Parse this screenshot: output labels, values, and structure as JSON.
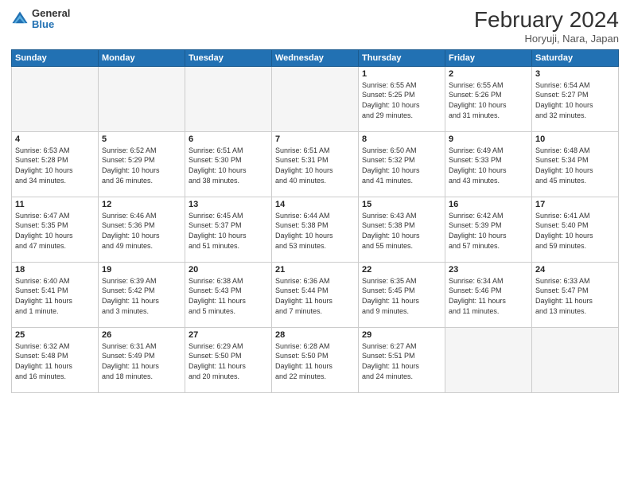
{
  "logo": {
    "general": "General",
    "blue": "Blue"
  },
  "title": "February 2024",
  "subtitle": "Horyuji, Nara, Japan",
  "headers": [
    "Sunday",
    "Monday",
    "Tuesday",
    "Wednesday",
    "Thursday",
    "Friday",
    "Saturday"
  ],
  "weeks": [
    [
      {
        "num": "",
        "info": "",
        "empty": true
      },
      {
        "num": "",
        "info": "",
        "empty": true
      },
      {
        "num": "",
        "info": "",
        "empty": true
      },
      {
        "num": "",
        "info": "",
        "empty": true
      },
      {
        "num": "1",
        "info": "Sunrise: 6:55 AM\nSunset: 5:25 PM\nDaylight: 10 hours\nand 29 minutes."
      },
      {
        "num": "2",
        "info": "Sunrise: 6:55 AM\nSunset: 5:26 PM\nDaylight: 10 hours\nand 31 minutes."
      },
      {
        "num": "3",
        "info": "Sunrise: 6:54 AM\nSunset: 5:27 PM\nDaylight: 10 hours\nand 32 minutes."
      }
    ],
    [
      {
        "num": "4",
        "info": "Sunrise: 6:53 AM\nSunset: 5:28 PM\nDaylight: 10 hours\nand 34 minutes."
      },
      {
        "num": "5",
        "info": "Sunrise: 6:52 AM\nSunset: 5:29 PM\nDaylight: 10 hours\nand 36 minutes."
      },
      {
        "num": "6",
        "info": "Sunrise: 6:51 AM\nSunset: 5:30 PM\nDaylight: 10 hours\nand 38 minutes."
      },
      {
        "num": "7",
        "info": "Sunrise: 6:51 AM\nSunset: 5:31 PM\nDaylight: 10 hours\nand 40 minutes."
      },
      {
        "num": "8",
        "info": "Sunrise: 6:50 AM\nSunset: 5:32 PM\nDaylight: 10 hours\nand 41 minutes."
      },
      {
        "num": "9",
        "info": "Sunrise: 6:49 AM\nSunset: 5:33 PM\nDaylight: 10 hours\nand 43 minutes."
      },
      {
        "num": "10",
        "info": "Sunrise: 6:48 AM\nSunset: 5:34 PM\nDaylight: 10 hours\nand 45 minutes."
      }
    ],
    [
      {
        "num": "11",
        "info": "Sunrise: 6:47 AM\nSunset: 5:35 PM\nDaylight: 10 hours\nand 47 minutes."
      },
      {
        "num": "12",
        "info": "Sunrise: 6:46 AM\nSunset: 5:36 PM\nDaylight: 10 hours\nand 49 minutes."
      },
      {
        "num": "13",
        "info": "Sunrise: 6:45 AM\nSunset: 5:37 PM\nDaylight: 10 hours\nand 51 minutes."
      },
      {
        "num": "14",
        "info": "Sunrise: 6:44 AM\nSunset: 5:38 PM\nDaylight: 10 hours\nand 53 minutes."
      },
      {
        "num": "15",
        "info": "Sunrise: 6:43 AM\nSunset: 5:38 PM\nDaylight: 10 hours\nand 55 minutes."
      },
      {
        "num": "16",
        "info": "Sunrise: 6:42 AM\nSunset: 5:39 PM\nDaylight: 10 hours\nand 57 minutes."
      },
      {
        "num": "17",
        "info": "Sunrise: 6:41 AM\nSunset: 5:40 PM\nDaylight: 10 hours\nand 59 minutes."
      }
    ],
    [
      {
        "num": "18",
        "info": "Sunrise: 6:40 AM\nSunset: 5:41 PM\nDaylight: 11 hours\nand 1 minute."
      },
      {
        "num": "19",
        "info": "Sunrise: 6:39 AM\nSunset: 5:42 PM\nDaylight: 11 hours\nand 3 minutes."
      },
      {
        "num": "20",
        "info": "Sunrise: 6:38 AM\nSunset: 5:43 PM\nDaylight: 11 hours\nand 5 minutes."
      },
      {
        "num": "21",
        "info": "Sunrise: 6:36 AM\nSunset: 5:44 PM\nDaylight: 11 hours\nand 7 minutes."
      },
      {
        "num": "22",
        "info": "Sunrise: 6:35 AM\nSunset: 5:45 PM\nDaylight: 11 hours\nand 9 minutes."
      },
      {
        "num": "23",
        "info": "Sunrise: 6:34 AM\nSunset: 5:46 PM\nDaylight: 11 hours\nand 11 minutes."
      },
      {
        "num": "24",
        "info": "Sunrise: 6:33 AM\nSunset: 5:47 PM\nDaylight: 11 hours\nand 13 minutes."
      }
    ],
    [
      {
        "num": "25",
        "info": "Sunrise: 6:32 AM\nSunset: 5:48 PM\nDaylight: 11 hours\nand 16 minutes."
      },
      {
        "num": "26",
        "info": "Sunrise: 6:31 AM\nSunset: 5:49 PM\nDaylight: 11 hours\nand 18 minutes."
      },
      {
        "num": "27",
        "info": "Sunrise: 6:29 AM\nSunset: 5:50 PM\nDaylight: 11 hours\nand 20 minutes."
      },
      {
        "num": "28",
        "info": "Sunrise: 6:28 AM\nSunset: 5:50 PM\nDaylight: 11 hours\nand 22 minutes."
      },
      {
        "num": "29",
        "info": "Sunrise: 6:27 AM\nSunset: 5:51 PM\nDaylight: 11 hours\nand 24 minutes."
      },
      {
        "num": "",
        "info": "",
        "empty": true
      },
      {
        "num": "",
        "info": "",
        "empty": true
      }
    ]
  ]
}
